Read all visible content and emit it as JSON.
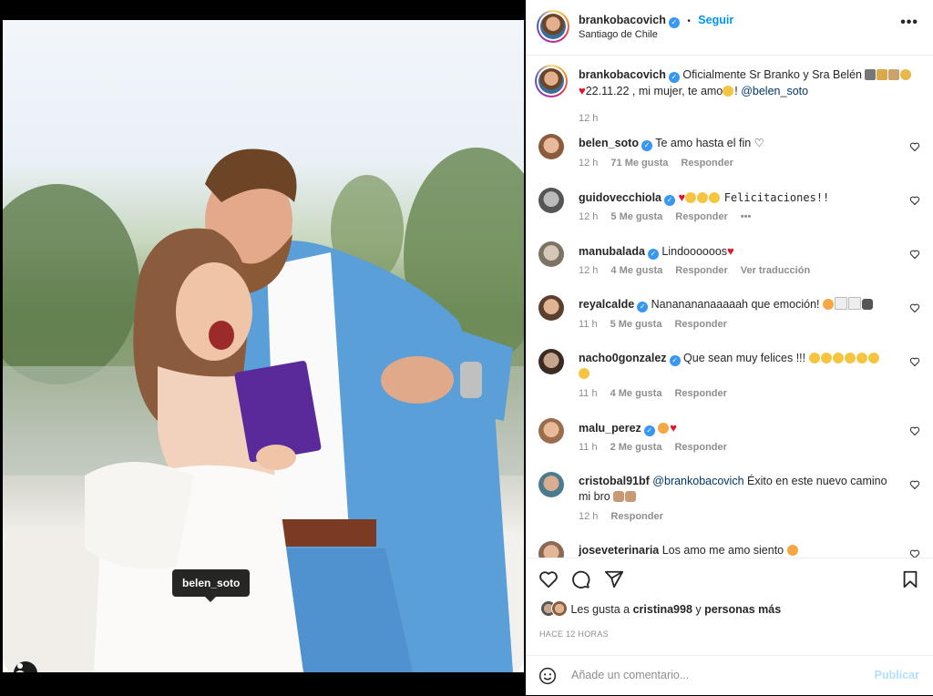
{
  "post": {
    "author": "brankobacovich",
    "follow_label": "Seguir",
    "location": "Santiago de Chile",
    "more": "•••",
    "tag_label": "belen_soto",
    "caption": {
      "username": "brankobacovich",
      "text_1": "Oficialmente Sr Branko y Sra Belén",
      "text_2": "22.11.22 , mi mujer, te amo",
      "text_3": "! ",
      "mention": "@belen_soto",
      "time": "12 h"
    }
  },
  "comments": [
    {
      "username": "belen_soto",
      "text": "Te amo hasta el fin ♡",
      "time": "12 h",
      "likes": "71 Me gusta",
      "reply": "Responder"
    },
    {
      "username": "guidovecchiola",
      "text": "Felicitaciones!!",
      "time": "12 h",
      "likes": "5 Me gusta",
      "reply": "Responder",
      "extra": "•••"
    },
    {
      "username": "manubalada",
      "text": "Lindoooooos",
      "time": "12 h",
      "likes": "4 Me gusta",
      "reply": "Responder",
      "extra": "Ver traducción"
    },
    {
      "username": "reyalcalde",
      "text": "Nananananaaaaah que emoción! ",
      "time": "11 h",
      "likes": "5 Me gusta",
      "reply": "Responder"
    },
    {
      "username": "nacho0gonzalez",
      "text": "Que sean muy felices !!! ",
      "time": "11 h",
      "likes": "4 Me gusta",
      "reply": "Responder"
    },
    {
      "username": "malu_perez",
      "text": "",
      "time": "11 h",
      "likes": "2 Me gusta",
      "reply": "Responder"
    },
    {
      "username": "cristobal91bf",
      "mention": "@brankobacovich",
      "text": " Éxito en este nuevo camino mi bro ",
      "time": "12 h",
      "reply": "Responder"
    },
    {
      "username": "joseveterinaria",
      "text": "Los amo me amo siento "
    }
  ],
  "likes": {
    "prefix": "Les gusta a ",
    "user": "cristina998",
    "middle": " y ",
    "suffix": "personas más"
  },
  "timestamp": "HACE 12 HORAS",
  "add_comment": {
    "placeholder": "Añade un comentario...",
    "publish": "Publicar"
  }
}
